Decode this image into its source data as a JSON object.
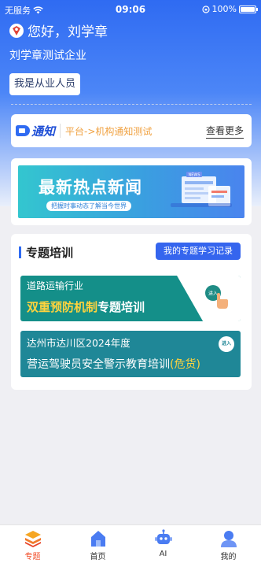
{
  "status_bar": {
    "carrier": "无服务",
    "time": "09:06",
    "battery": "100%"
  },
  "header": {
    "greeting": "您好，刘学章",
    "company": "刘学章测试企业",
    "role_button": "我是从业人员"
  },
  "notice": {
    "logo_text": "通知",
    "message": "平台->机构通知测试",
    "more": "查看更多"
  },
  "banner": {
    "title": "最新热点新闻",
    "subtitle": "把握时事动态了解当今世界",
    "art_label": "NEWS"
  },
  "topics": {
    "title": "专题培训",
    "record_button": "我的专题学习记录",
    "courses": [
      {
        "line1": "道路运输行业",
        "line2_highlight": "双重预防机制",
        "line2_rest": "专题培训",
        "enter": "进入"
      },
      {
        "line1": "达州市达川区2024年度",
        "line2_main": "营运驾驶员安全警示教育培训",
        "line2_highlight": "(危货)",
        "enter": "进入"
      }
    ]
  },
  "tabbar": {
    "items": [
      {
        "label": "专题",
        "icon": "layers-icon",
        "active": true
      },
      {
        "label": "首页",
        "icon": "home-icon",
        "active": false
      },
      {
        "label": "AI",
        "icon": "robot-icon",
        "active": false
      },
      {
        "label": "我的",
        "icon": "user-icon",
        "active": false
      }
    ]
  },
  "colors": {
    "primary": "#2f6bf2",
    "accent_active": "#f04a25",
    "course_teal": "#148f89",
    "highlight_yellow": "#ffd33d"
  }
}
